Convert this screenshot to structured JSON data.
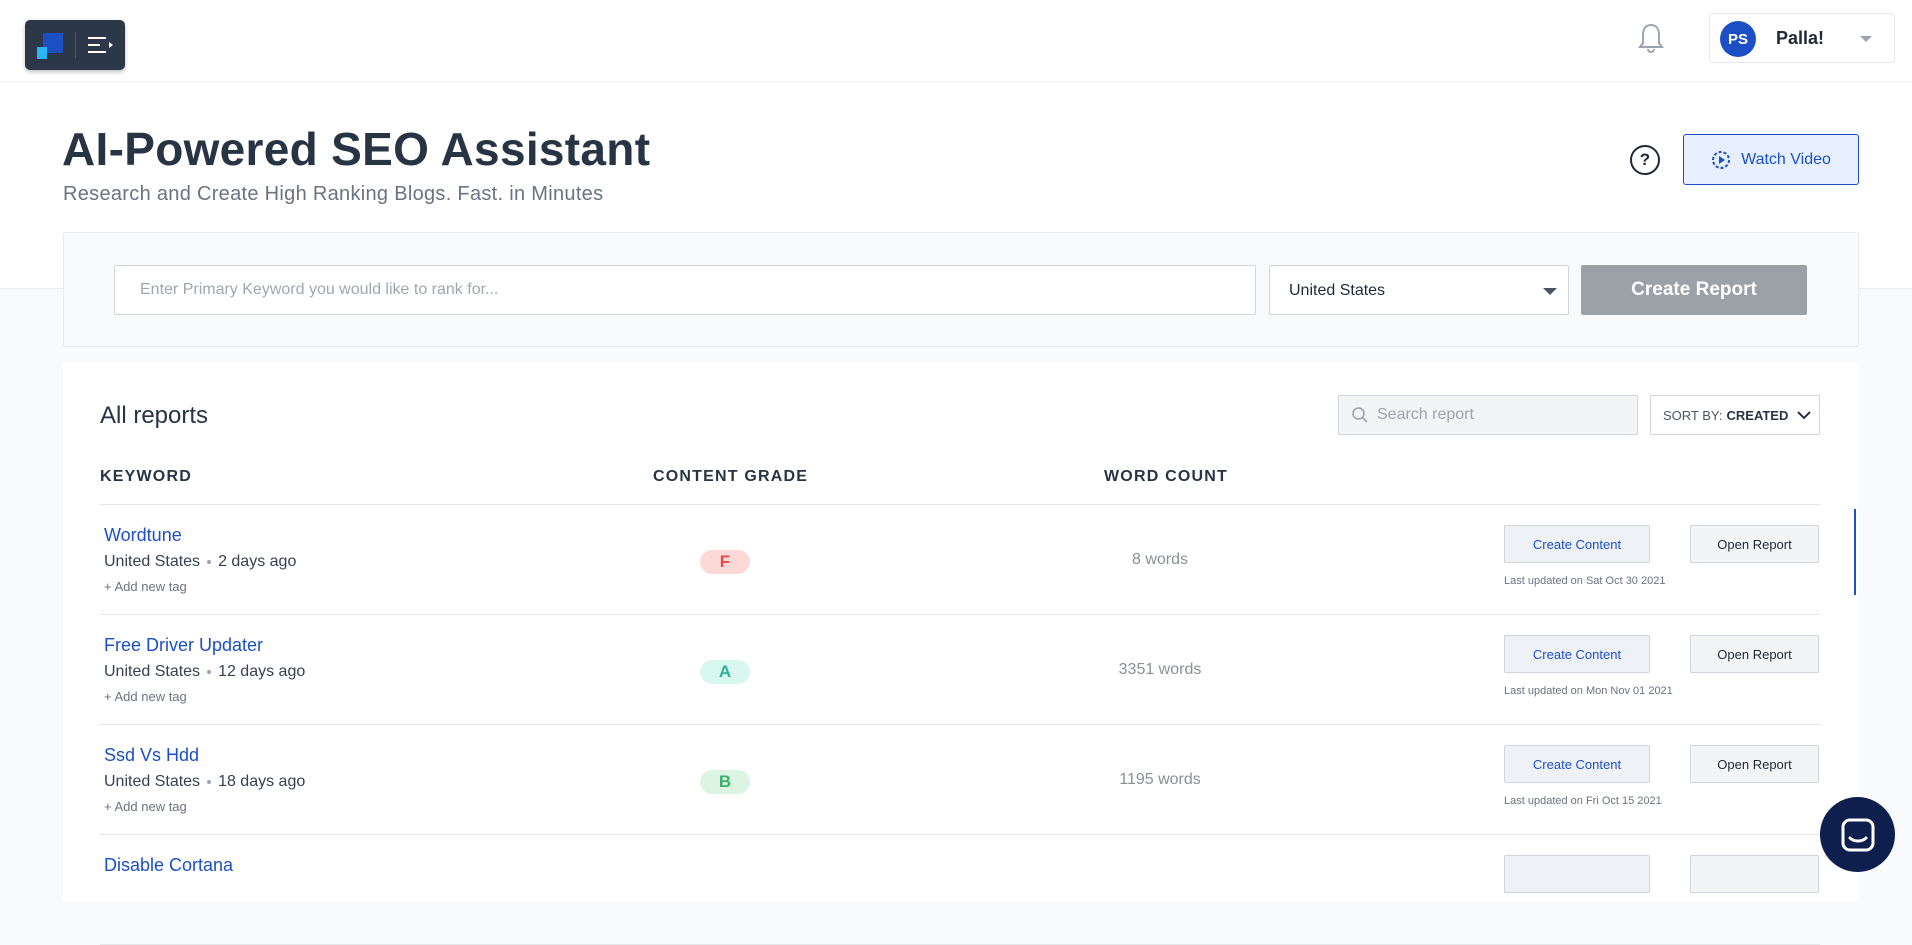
{
  "topbar": {
    "user": {
      "initials": "PS",
      "name": "Palla!"
    }
  },
  "hero": {
    "title": "AI-Powered SEO Assistant",
    "subtitle": "Research and Create High Ranking Blogs. Fast. in Minutes",
    "help_symbol": "?",
    "watch_video_label": "Watch Video"
  },
  "search": {
    "keyword_placeholder": "Enter Primary Keyword you would like to rank for...",
    "country": "United States",
    "create_report_label": "Create Report"
  },
  "reports": {
    "title": "All reports",
    "search_placeholder": "Search report",
    "sort_label": "SORT BY:",
    "sort_value": "CREATED",
    "columns": {
      "keyword": "KEYWORD",
      "grade": "CONTENT GRADE",
      "word_count": "WORD COUNT"
    },
    "rows": [
      {
        "keyword": "Wordtune",
        "country": "United States",
        "age": "2 days ago",
        "add_tag": "+ Add new tag",
        "grade": "F",
        "grade_bg": "#fcd9d6",
        "grade_color": "#e5484d",
        "words": "8 words",
        "create_content": "Create Content",
        "open_report": "Open Report",
        "last_updated": "Last updated on Sat Oct 30 2021"
      },
      {
        "keyword": "Free Driver Updater",
        "country": "United States",
        "age": "12 days ago",
        "add_tag": "+ Add new tag",
        "grade": "A",
        "grade_bg": "#d8f7ef",
        "grade_color": "#2bb393",
        "words": "3351 words",
        "create_content": "Create Content",
        "open_report": "Open Report",
        "last_updated": "Last updated on Mon Nov 01 2021"
      },
      {
        "keyword": "Ssd Vs Hdd",
        "country": "United States",
        "age": "18 days ago",
        "add_tag": "+ Add new tag",
        "grade": "B",
        "grade_bg": "#dcf5e3",
        "grade_color": "#3bb26a",
        "words": "1195 words",
        "create_content": "Create Content",
        "open_report": "Open Report",
        "last_updated": "Last updated on Fri Oct 15 2021"
      },
      {
        "keyword": "Disable Cortana",
        "country": "",
        "age": "",
        "add_tag": "",
        "grade": "",
        "grade_bg": "#ffffff",
        "grade_color": "#ffffff",
        "words": "",
        "create_content": "",
        "open_report": "",
        "last_updated": ""
      }
    ]
  },
  "colors": {
    "accent": "#1d4fc4",
    "logo_bg": "#2c3748",
    "chat_bg": "#0f1f4d"
  },
  "icons": [
    "logo-icon",
    "menu-icon",
    "bell-icon",
    "chevron-down-icon",
    "help-icon",
    "play-circle-icon",
    "search-icon",
    "chat-icon"
  ]
}
